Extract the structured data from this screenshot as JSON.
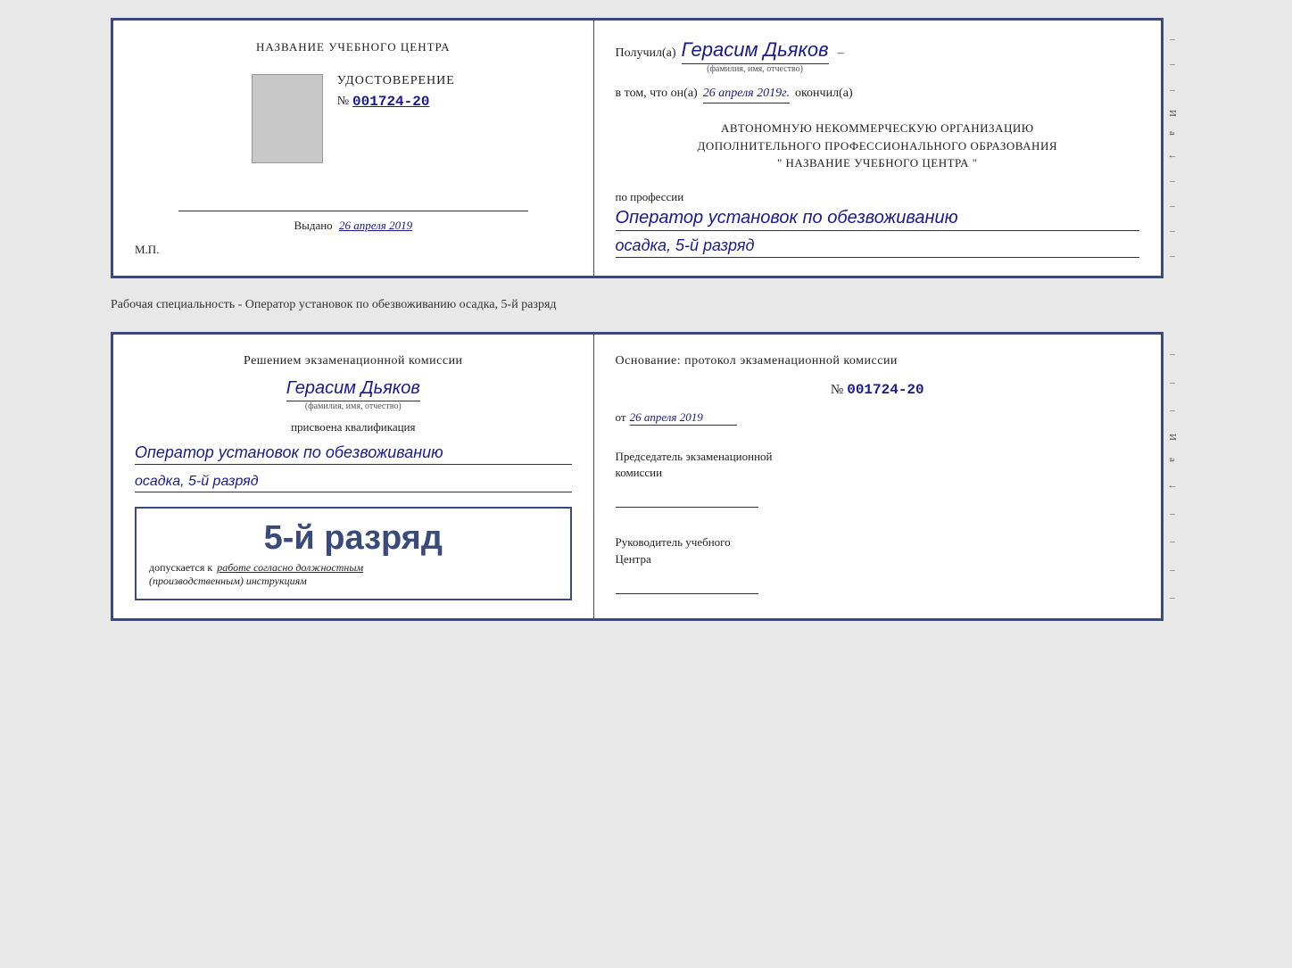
{
  "top_cert": {
    "left": {
      "school_name": "НАЗВАНИЕ УЧЕБНОГО ЦЕНТРА",
      "cert_title": "УДОСТОВЕРЕНИЕ",
      "cert_number_prefix": "№",
      "cert_number": "001724-20",
      "issued_label": "Выдано",
      "issued_date": "26 апреля 2019",
      "mp_label": "М.П."
    },
    "right": {
      "recipient_prefix": "Получил(а)",
      "recipient_name": "Герасим Дьяков",
      "recipient_sub": "(фамилия, имя, отчество)",
      "date_prefix": "в том, что он(а)",
      "date_value": "26 апреля 2019г.",
      "date_suffix": "окончил(а)",
      "org_line1": "АВТОНОМНУЮ НЕКОММЕРЧЕСКУЮ ОРГАНИЗАЦИЮ",
      "org_line2": "ДОПОЛНИТЕЛЬНОГО ПРОФЕССИОНАЛЬНОГО ОБРАЗОВАНИЯ",
      "org_line3": "\"    НАЗВАНИЕ УЧЕБНОГО ЦЕНТРА    \"",
      "profession_label": "по профессии",
      "profession_line1": "Оператор установок по обезвоживанию",
      "profession_line2": "осадка, 5-й разряд"
    }
  },
  "separator": {
    "text": "Рабочая специальность - Оператор установок по обезвоживанию осадка, 5-й разряд"
  },
  "bottom_cert": {
    "left": {
      "decision_title": "Решением экзаменационной комиссии",
      "name": "Герасим Дьяков",
      "name_sub": "(фамилия, имя, отчество)",
      "assigned_label": "присвоена квалификация",
      "qualification_line1": "Оператор установок по обезвоживанию",
      "qualification_line2": "осадка, 5-й разряд",
      "rank_display": "5-й разряд",
      "allowed_prefix": "допускается к",
      "allowed_text": "работе согласно должностным",
      "allowed_suffix": "(производственным) инструкциям"
    },
    "right": {
      "basis_title": "Основание: протокол экзаменационной комиссии",
      "protocol_prefix": "№",
      "protocol_number": "001724-20",
      "date_prefix": "от",
      "date_value": "26 апреля 2019",
      "chairman_label": "Председатель экзаменационной",
      "chairman_label2": "комиссии",
      "director_label": "Руководитель учебного",
      "director_label2": "Центра"
    }
  },
  "deco": {
    "chars": [
      "–",
      "–",
      "–",
      "И",
      "а",
      "←",
      "–",
      "–",
      "–",
      "–"
    ]
  }
}
